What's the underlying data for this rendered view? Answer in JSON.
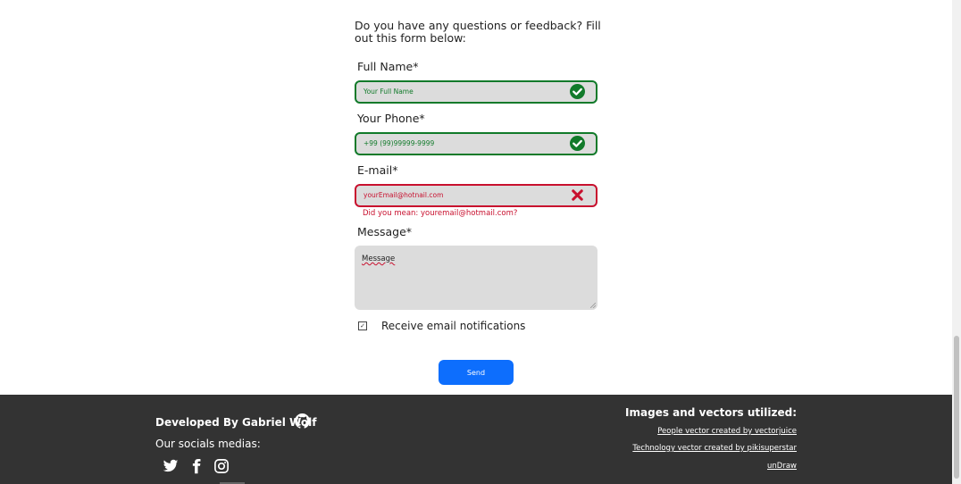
{
  "form": {
    "intro": "Do you have any questions or feedback? Fill out this form below:",
    "fields": [
      {
        "label": "Full Name*",
        "value": "Your Full Name",
        "status": "valid"
      },
      {
        "label": "Your Phone*",
        "value": "+99 (99)99999-9999",
        "status": "valid"
      },
      {
        "label": "E-mail*",
        "value": "yourEmail@hotnail.com",
        "status": "invalid",
        "hint": "Did you mean: youremail@hotmail.com?"
      }
    ],
    "message": {
      "label": "Message*",
      "placeholder": "Message"
    },
    "notifications": {
      "label": "Receive email notifications",
      "checked": true
    },
    "send_label": "Send"
  },
  "footer": {
    "developed_by": "Developed By Gabriel Wolf",
    "socials_title": "Our socials medias:",
    "socials": [
      "twitter-icon",
      "facebook-icon",
      "instagram-icon"
    ],
    "credits_title": "Images and vectors utilized:",
    "credits": [
      "People vector created by vectorjuice",
      "Technology vector created by pikisuperstar",
      "unDraw"
    ]
  },
  "colors": {
    "valid": "#117a2a",
    "invalid": "#c8102e",
    "button": "#0d6efd",
    "footer_bg": "#333333",
    "field_bg": "#dcdcdc"
  }
}
